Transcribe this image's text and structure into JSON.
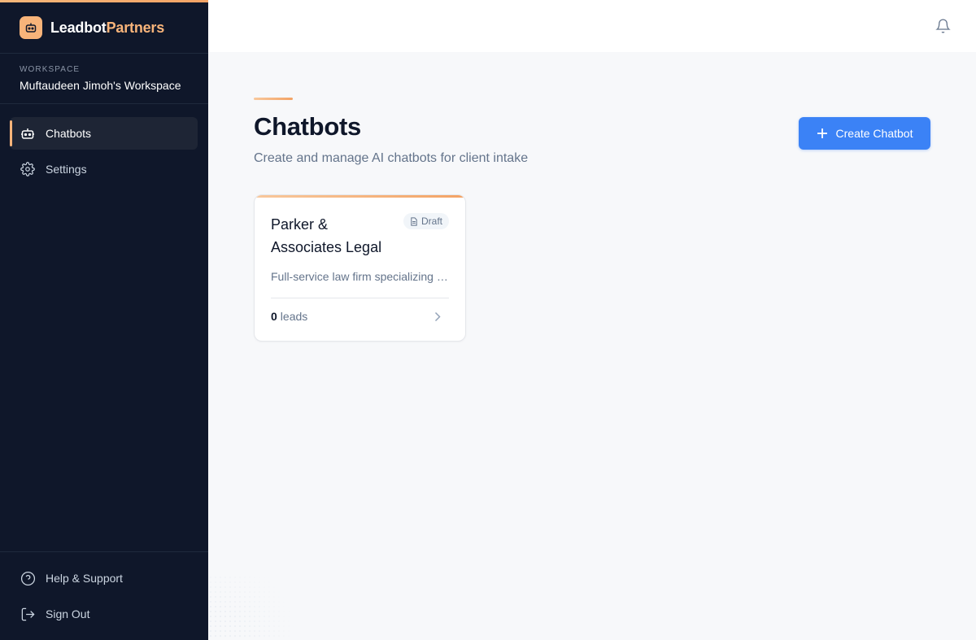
{
  "brand": {
    "name_part1": "Leadbot",
    "name_part2": "Partners",
    "logo_icon": "robot-icon",
    "accent": "#f8b47a"
  },
  "workspace": {
    "label": "WORKSPACE",
    "name": "Muftaudeen Jimoh's Workspace"
  },
  "nav": {
    "items": [
      {
        "label": "Chatbots",
        "icon": "robot-icon",
        "active": true
      },
      {
        "label": "Settings",
        "icon": "gear-icon",
        "active": false
      }
    ],
    "bottom": [
      {
        "label": "Help & Support",
        "icon": "help-circle-icon"
      },
      {
        "label": "Sign Out",
        "icon": "logout-icon"
      }
    ]
  },
  "header": {
    "notification_icon": "bell-icon"
  },
  "page": {
    "title": "Chatbots",
    "subtitle": "Create and manage AI chatbots for client intake",
    "create_button": "Create Chatbot"
  },
  "chatbots": [
    {
      "name": "Parker & Associates Legal",
      "status": "Draft",
      "description": "Full-service law firm specializing in family and estate law",
      "leads_count": "0",
      "leads_label": "leads"
    }
  ],
  "colors": {
    "sidebar_bg": "#0f172a",
    "primary": "#3b82f6",
    "accent": "#f8b47a",
    "page_bg": "#f7f8fa"
  }
}
